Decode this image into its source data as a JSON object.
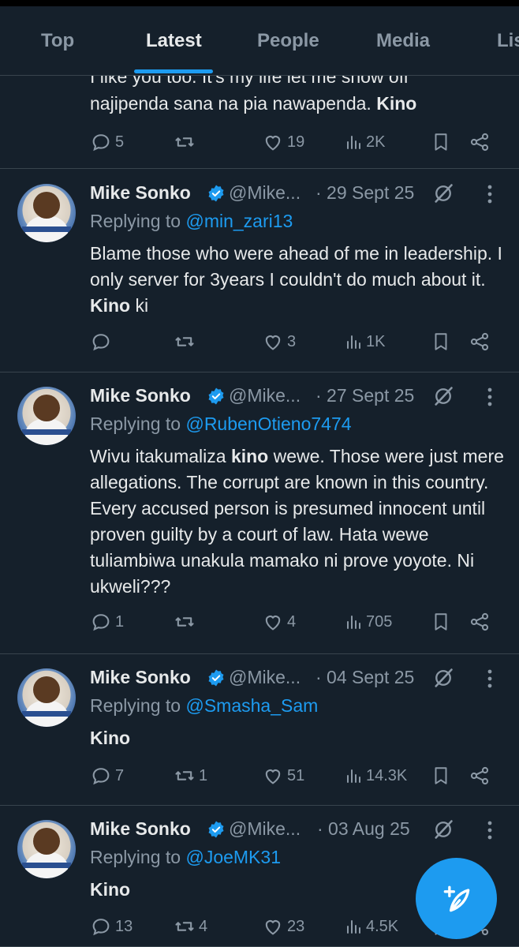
{
  "tabs": [
    {
      "label": "Top"
    },
    {
      "label": "Latest"
    },
    {
      "label": "People"
    },
    {
      "label": "Media"
    },
    {
      "label": "Lis"
    }
  ],
  "partial_tweet": {
    "line1": "I like you too. It's my life let me show off",
    "line2": "najipenda sana na pia nawapenda. ",
    "line2_bold": "Kino",
    "replies": "5",
    "reposts": "",
    "likes": "19",
    "views": "2K"
  },
  "tweets": [
    {
      "name": "Mike Sonko",
      "handle": "@Mike...",
      "date": "· 29 Sept 25",
      "replying_prefix": "Replying to ",
      "replying_to": "@min_zari13",
      "text_before": "Blame those who were ahead of me in leadership. I only server for 3years I couldn't do much about it. ",
      "bold": "Kino",
      "text_after": " ki",
      "replies": "",
      "reposts": "",
      "likes": "3",
      "views": "1K"
    },
    {
      "name": "Mike Sonko",
      "handle": "@Mike...",
      "date": "· 27 Sept 25",
      "replying_prefix": "Replying to ",
      "replying_to": "@RubenOtieno7474",
      "text_before": "Wivu itakumaliza ",
      "bold": "kino",
      "text_after": " wewe. Those were just mere allegations. The corrupt are known in this country. Every accused person is presumed innocent until proven guilty by a court of law. Hata wewe tuliambiwa unakula mamako ni prove yoyote. Ni ukweli???",
      "replies": "1",
      "reposts": "",
      "likes": "4",
      "views": "705"
    },
    {
      "name": "Mike Sonko",
      "handle": "@Mike...",
      "date": "· 04 Sept 25",
      "replying_prefix": "Replying to ",
      "replying_to": "@Smasha_Sam",
      "text_before": "",
      "bold": "Kino",
      "text_after": "",
      "replies": "7",
      "reposts": "1",
      "likes": "51",
      "views": "14.3K"
    },
    {
      "name": "Mike Sonko",
      "handle": "@Mike...",
      "date": "· 03 Aug 25",
      "replying_prefix": "Replying to ",
      "replying_to": "@JoeMK31",
      "text_before": "",
      "bold": "Kino",
      "text_after": "",
      "replies": "13",
      "reposts": "4",
      "likes": "23",
      "views": "4.5K"
    }
  ],
  "icons": {
    "reply": "reply-icon",
    "repost": "repost-icon",
    "like": "heart-icon",
    "views": "views-icon",
    "bookmark": "bookmark-icon",
    "share": "share-icon",
    "verified": "verified-badge-icon",
    "grok": "grok-icon",
    "more": "more-icon",
    "compose": "compose-post-icon"
  },
  "colors": {
    "background": "#15202b",
    "accent": "#1d9bf0",
    "text": "#e7e9ea",
    "muted": "#8b98a5",
    "divider": "#38444d"
  }
}
